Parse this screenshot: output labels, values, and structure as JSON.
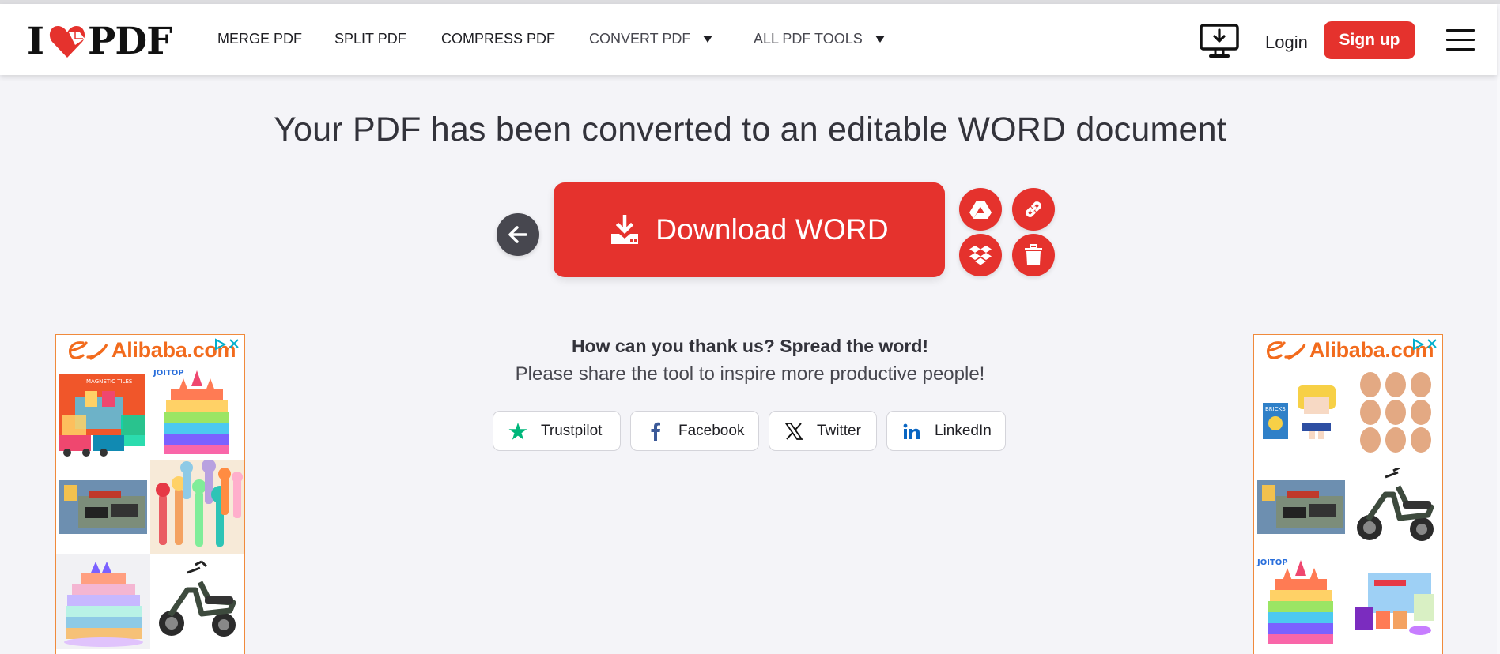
{
  "header": {
    "logo": {
      "left": "I",
      "right": "PDF"
    },
    "nav": [
      {
        "label": "MERGE PDF",
        "dropdown": false
      },
      {
        "label": "SPLIT PDF",
        "dropdown": false
      },
      {
        "label": "COMPRESS PDF",
        "dropdown": false
      },
      {
        "label": "CONVERT PDF",
        "dropdown": true
      },
      {
        "label": "ALL PDF TOOLS",
        "dropdown": true
      }
    ],
    "desktop_icon": "desktop-download-icon",
    "login_label": "Login",
    "signup_label": "Sign up",
    "menu_icon": "hamburger-menu-icon"
  },
  "main": {
    "title": "Your PDF has been converted to an editable WORD document",
    "back_icon": "arrow-left-icon",
    "download_label": "Download WORD",
    "download_icon": "download-icon",
    "actions": [
      {
        "name": "google-drive",
        "icon": "google-drive-icon"
      },
      {
        "name": "copy-link",
        "icon": "link-icon"
      },
      {
        "name": "dropbox",
        "icon": "dropbox-icon"
      },
      {
        "name": "delete",
        "icon": "trash-icon"
      }
    ]
  },
  "share": {
    "title": "How can you thank us? Spread the word!",
    "subtitle": "Please share the tool to inspire more productive people!",
    "buttons": [
      {
        "label": "Trustpilot",
        "icon": "trustpilot-star-icon"
      },
      {
        "label": "Facebook",
        "icon": "facebook-icon"
      },
      {
        "label": "Twitter",
        "icon": "x-twitter-icon"
      },
      {
        "label": "LinkedIn",
        "icon": "linkedin-icon"
      }
    ]
  },
  "ads": {
    "brand": "Alibaba.com",
    "left_products": [
      "Magnetic tiles set",
      "JOITOP magnetic castle",
      "Building blocks police set",
      "Bubble wand toys",
      "Magnetic tiles castle",
      "Electric trike scooter"
    ],
    "right_products": [
      "BRICKS figure",
      "Silicone suture pads",
      "Building blocks police set",
      "Electric trike scooter",
      "JOITOP magnetic castle",
      "Magnetic building set"
    ],
    "joitop_label": "JOITOP",
    "bricks_label": "BRICKS",
    "colors": {
      "brand_orange": "#f26b1d",
      "adchoices_blue": "#00aecd"
    }
  },
  "colors": {
    "accent_red": "#e5322d",
    "back_button": "#47474f",
    "page_bg": "#f4f4f8",
    "text": "#33333b",
    "trustpilot_green": "#00b67a",
    "facebook_blue": "#3b5998",
    "linkedin_blue": "#0a66c2"
  }
}
